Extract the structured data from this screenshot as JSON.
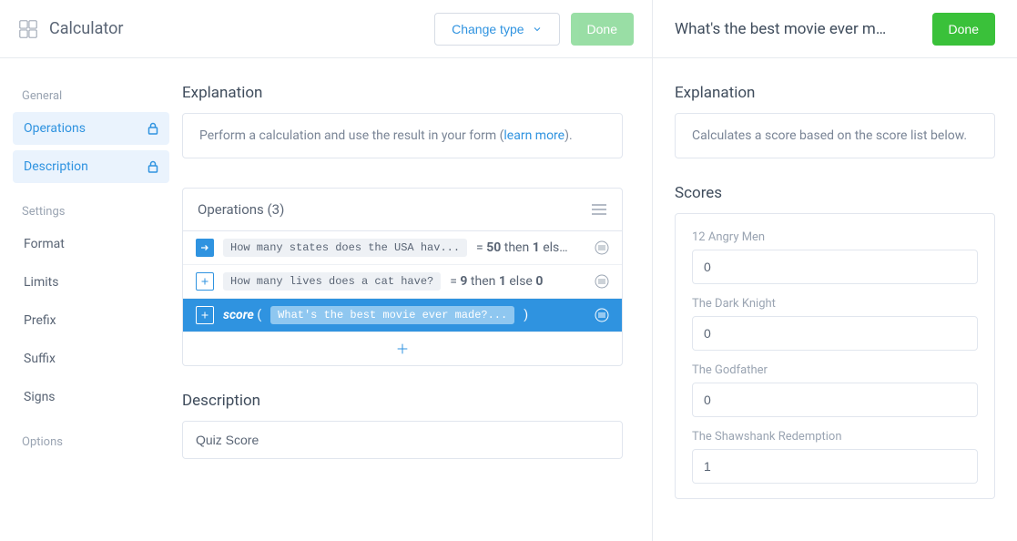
{
  "header": {
    "title": "Calculator",
    "change_type": "Change type",
    "done": "Done"
  },
  "sidebar": {
    "groups": [
      {
        "title": "General",
        "items": [
          {
            "label": "Operations",
            "locked": true,
            "active": true,
            "name": "sidebar-item-operations"
          },
          {
            "label": "Description",
            "locked": true,
            "active": true,
            "name": "sidebar-item-description"
          }
        ]
      },
      {
        "title": "Settings",
        "items": [
          {
            "label": "Format",
            "name": "sidebar-item-format"
          },
          {
            "label": "Limits",
            "name": "sidebar-item-limits"
          },
          {
            "label": "Prefix",
            "name": "sidebar-item-prefix"
          },
          {
            "label": "Suffix",
            "name": "sidebar-item-suffix"
          },
          {
            "label": "Signs",
            "name": "sidebar-item-signs"
          }
        ]
      },
      {
        "title": "Options",
        "items": []
      }
    ]
  },
  "main": {
    "explanation_title": "Explanation",
    "explanation_text": "Perform a calculation and use the result in your form (",
    "learn_more": "learn more",
    "explanation_tail": ").",
    "operations_title": "Operations (3)",
    "rows": [
      {
        "icon": "arrow",
        "chip": "How many states does the USA hav...",
        "expr_html": "= <b>50</b> then <b>1</b> els…",
        "selected": false
      },
      {
        "icon": "plus",
        "chip": "How many lives does a cat have?",
        "expr_html": "= <b>9</b> then <b>1</b> else <b>0</b>",
        "selected": false
      },
      {
        "icon": "plus",
        "prefix_html": "<span class=\"italic\"><b>score</b></span> (",
        "chip": "What's the best movie ever made?...",
        "suffix_html": ")",
        "selected": true
      }
    ],
    "description_title": "Description",
    "description_value": "Quiz Score"
  },
  "right": {
    "title": "What's the best movie ever m…",
    "done": "Done",
    "explanation_title": "Explanation",
    "explanation_text": "Calculates a score based on the score list below.",
    "scores_title": "Scores",
    "scores": [
      {
        "label": "12 Angry Men",
        "value": "0"
      },
      {
        "label": "The Dark Knight",
        "value": "0"
      },
      {
        "label": "The Godfather",
        "value": "0"
      },
      {
        "label": "The Shawshank Redemption",
        "value": "1"
      }
    ]
  }
}
